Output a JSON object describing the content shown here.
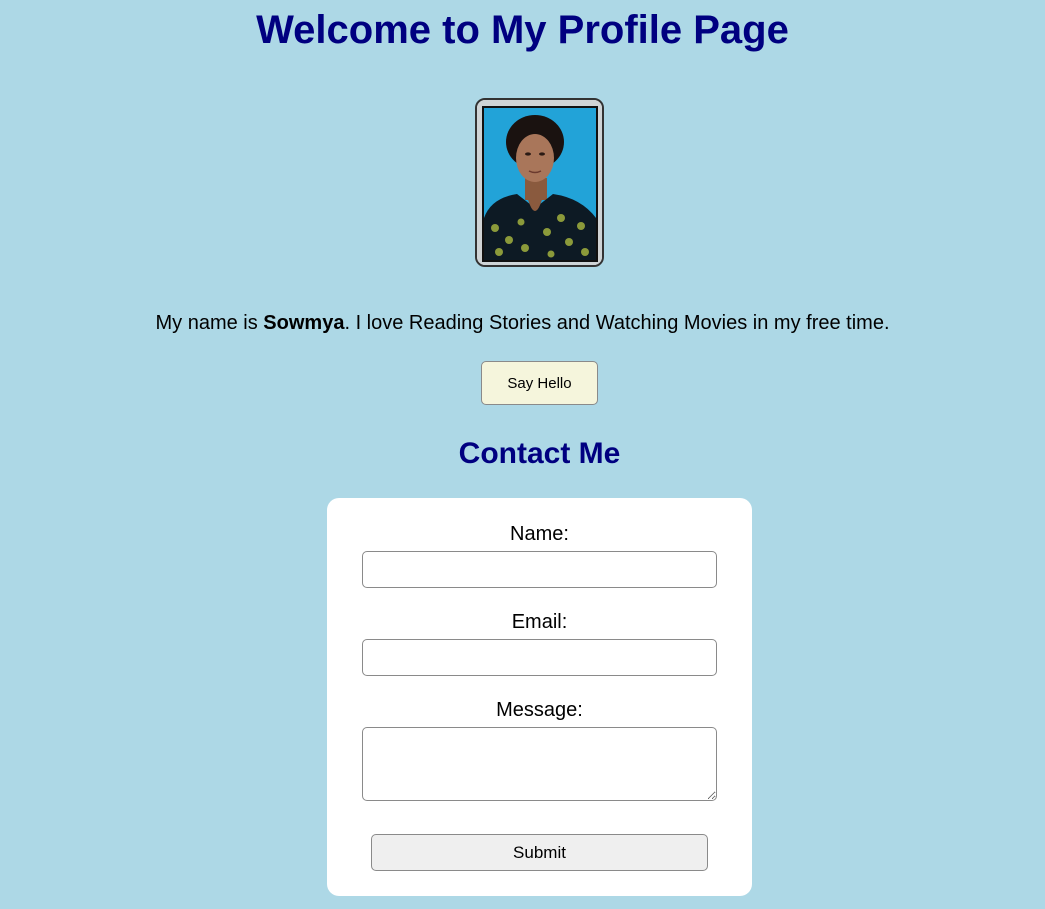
{
  "header": {
    "title": "Welcome to My Profile Page"
  },
  "profile": {
    "intro_prefix": "My name is ",
    "name": "Sowmya",
    "intro_suffix": ". I love Reading Stories and Watching Movies in my free time.",
    "say_hello_label": "Say Hello"
  },
  "contact": {
    "heading": "Contact Me",
    "name_label": "Name:",
    "name_value": "",
    "email_label": "Email:",
    "email_value": "",
    "message_label": "Message:",
    "message_value": "",
    "submit_label": "Submit"
  },
  "colors": {
    "page_background": "#add8e6",
    "heading": "#000080",
    "say_hello_background": "#f5f5dc",
    "card_background": "#ffffff"
  }
}
